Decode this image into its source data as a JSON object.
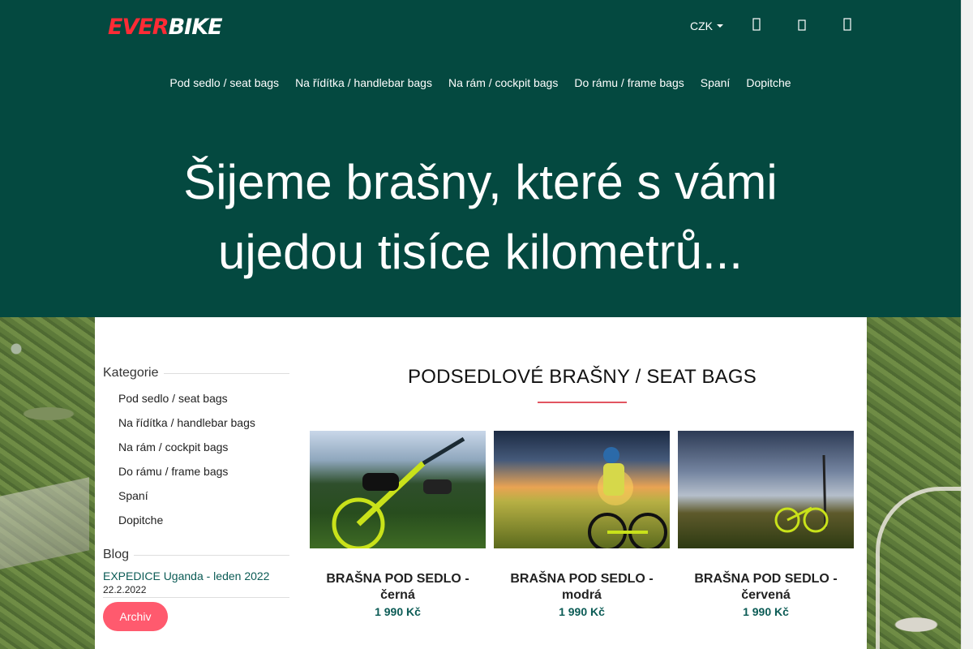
{
  "header": {
    "logo_text_red": "EVER",
    "logo_text_white": "BIKE",
    "currency": "CZK",
    "icons": [
      "user-icon",
      "heart-icon",
      "cart-icon"
    ]
  },
  "nav": {
    "items": [
      {
        "label": "Pod sedlo / seat bags"
      },
      {
        "label": "Na řídítka / handlebar bags"
      },
      {
        "label": "Na rám / cockpit bags"
      },
      {
        "label": "Do rámu / frame bags"
      },
      {
        "label": "Spaní"
      },
      {
        "label": "Dopitche"
      }
    ]
  },
  "hero": {
    "line1": "Šijeme brašny, které s vámi",
    "line2": "ujedou tisíce kilometrů..."
  },
  "sidebar": {
    "categories_heading": "Kategorie",
    "categories": [
      {
        "label": "Pod sedlo / seat bags"
      },
      {
        "label": "Na řídítka / handlebar bags"
      },
      {
        "label": "Na rám / cockpit bags"
      },
      {
        "label": "Do rámu / frame bags"
      },
      {
        "label": "Spaní"
      },
      {
        "label": "Dopitche"
      }
    ],
    "blog_heading": "Blog",
    "blog_post_title": "EXPEDICE Uganda - leden 2022",
    "blog_post_date": "22.2.2022",
    "archive_button": "Archiv"
  },
  "main": {
    "title": "PODSEDLOVÉ BRAŠNY / SEAT BAGS",
    "products": [
      {
        "name": "BRAŠNA POD SEDLO - černá",
        "price": "1 990 Kč"
      },
      {
        "name": "BRAŠNA POD SEDLO - modrá",
        "price": "1 990 Kč"
      },
      {
        "name": "BRAŠNA POD SEDLO - červená",
        "price": "1 990 Kč"
      }
    ]
  },
  "colors": {
    "header_bg": "#044940",
    "accent_red": "#e25561",
    "button_pink": "#ff5a6e",
    "link_green": "#0b5b55"
  }
}
